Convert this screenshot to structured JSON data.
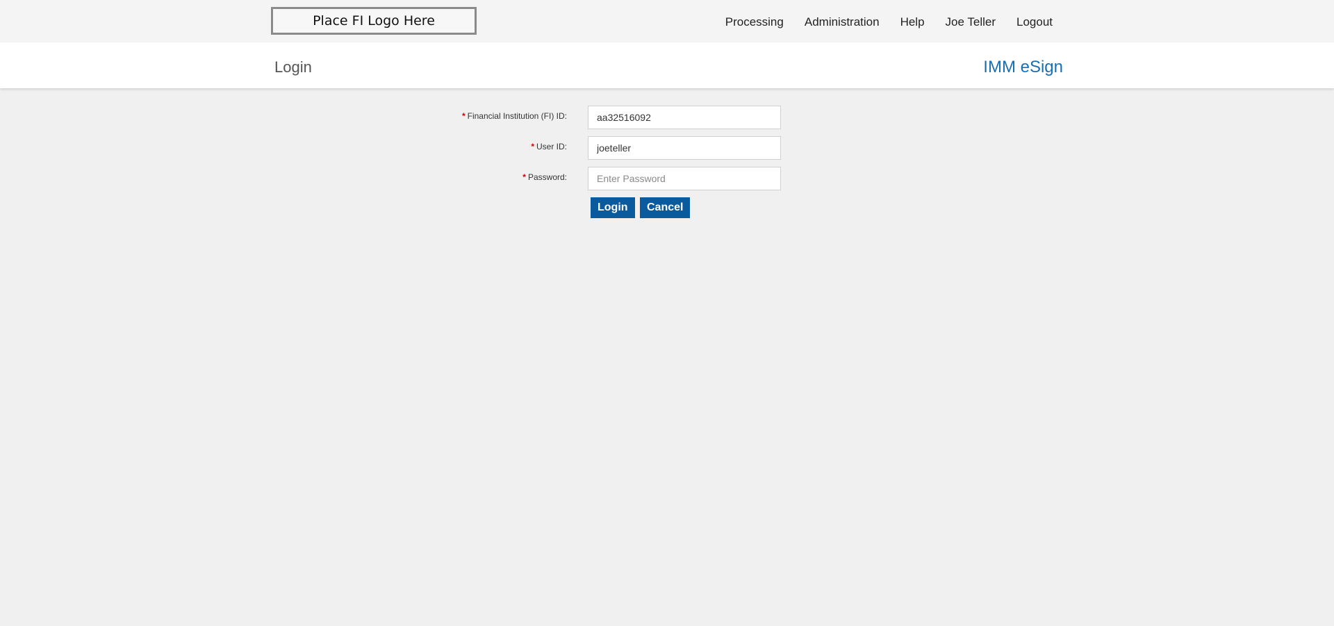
{
  "header": {
    "logo_text": "Place FI Logo Here",
    "nav": [
      {
        "label": "Processing"
      },
      {
        "label": "Administration"
      },
      {
        "label": "Help"
      },
      {
        "label": "Joe Teller"
      },
      {
        "label": "Logout"
      }
    ]
  },
  "subheader": {
    "page_title": "Login",
    "app_name": "IMM eSign"
  },
  "form": {
    "required_marker": "*",
    "fi_id": {
      "label": "Financial Institution (FI) ID:",
      "value": "aa32516092"
    },
    "user_id": {
      "label": "User ID:",
      "value": "joeteller"
    },
    "password": {
      "label": "Password:",
      "placeholder": "Enter Password",
      "value": ""
    },
    "login_label": "Login",
    "cancel_label": "Cancel"
  },
  "colors": {
    "accent": "#0a5a9e",
    "app_name": "#1a6fb3",
    "required": "#d40000"
  }
}
